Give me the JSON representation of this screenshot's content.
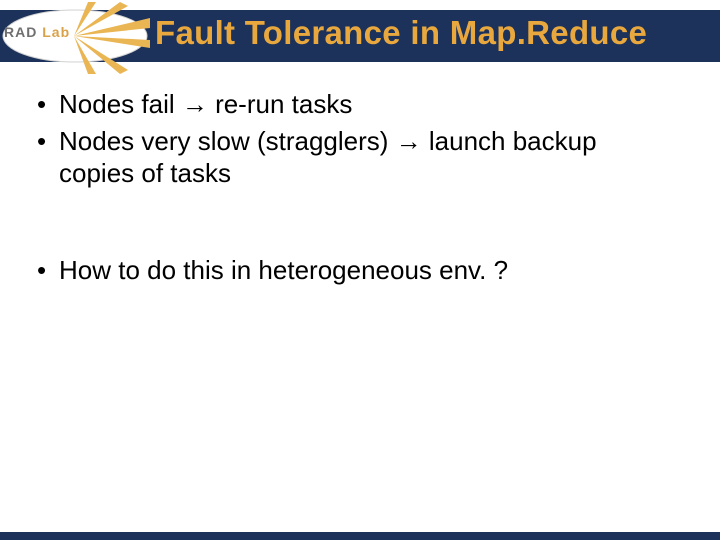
{
  "logo": {
    "text_a": "RAD",
    "text_b": "Lab"
  },
  "title": "Fault Tolerance in Map.Reduce",
  "bullets": {
    "b0": "Nodes fail → re-run tasks",
    "b1": "Nodes very slow (stragglers) → launch backup copies of tasks",
    "b2": "How to do this in heterogeneous env. ?"
  }
}
